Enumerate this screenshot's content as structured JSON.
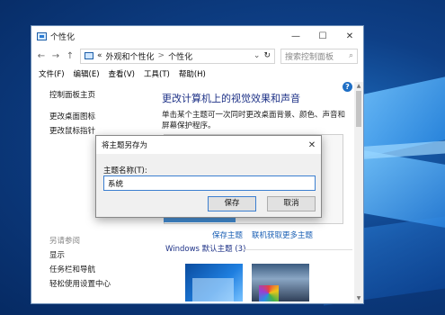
{
  "window": {
    "title": "个性化",
    "controls": {
      "minimize": "—",
      "maximize": "☐",
      "close": "✕"
    }
  },
  "address": {
    "back": "←",
    "forward": "→",
    "up": "↑",
    "prefix": "«",
    "crumbs": [
      "外观和个性化",
      "个性化"
    ],
    "separator": ">",
    "dropdown": "⌄",
    "refresh": "↻",
    "search_placeholder": "搜索控制面板",
    "search_glyph": "⌕"
  },
  "menu": [
    "文件(F)",
    "编辑(E)",
    "查看(V)",
    "工具(T)",
    "帮助(H)"
  ],
  "left_pane": {
    "home": "控制面板主页",
    "links": [
      "更改桌面图标",
      "更改鼠标指针"
    ],
    "see_also_heading": "另请参阅",
    "see_also": [
      "显示",
      "任务栏和导航",
      "轻松使用设置中心"
    ]
  },
  "main": {
    "help_glyph": "?",
    "title": "更改计算机上的视觉效果和声音",
    "description": "单击某个主题可一次同时更改桌面背景、颜色、声音和屏幕保护程序。",
    "save_theme": "保存主题",
    "get_more_themes": "联机获取更多主题",
    "windows_themes_heading": "Windows 默认主题 (3)"
  },
  "dialog": {
    "title": "将主题另存为",
    "close": "✕",
    "label": "主题名称(T):",
    "input_value": "系统",
    "save_button": "保存",
    "cancel_button": "取消"
  },
  "colors": {
    "link": "#1a5fb4",
    "heading": "#1e3287",
    "accent": "#3c7fd0"
  }
}
